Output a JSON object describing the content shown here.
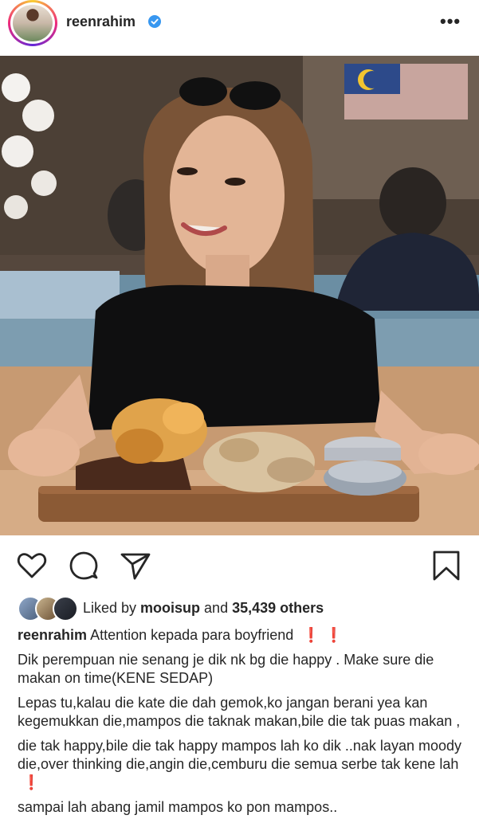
{
  "post": {
    "username": "reenrahim",
    "verified_icon": "verified-badge-icon",
    "more_label": "•••",
    "accent": "#3897f0"
  },
  "likes": {
    "prefix": "Liked by ",
    "liker": "mooisup",
    "middle": " and ",
    "count": "35,439 others"
  },
  "caption": {
    "username": "reenrahim",
    "line1": "Attention kepada para boyfriend",
    "para1": "Dik perempuan nie senang je dik nk bg die happy . Make sure die makan on time(KENE SEDAP)",
    "para2": "Lepas tu,kalau die kate die dah gemok,ko jangan berani yea kan kegemukkan die,mampos die taknak makan,bile die tak puas makan ,",
    "para3": "die tak happy,bile die tak happy mampos lah ko dik ..nak layan moody die,over thinking die,angin die,cemburu die semua serbe tak kene lah",
    "para4": "sampai lah abang jamil mampos ko pon mampos.."
  },
  "icons": {
    "like": "heart-icon",
    "comment": "comment-icon",
    "share": "send-icon",
    "save": "bookmark-icon"
  },
  "colors": {
    "text": "#262626",
    "emoji_red": "#ed1c24"
  }
}
